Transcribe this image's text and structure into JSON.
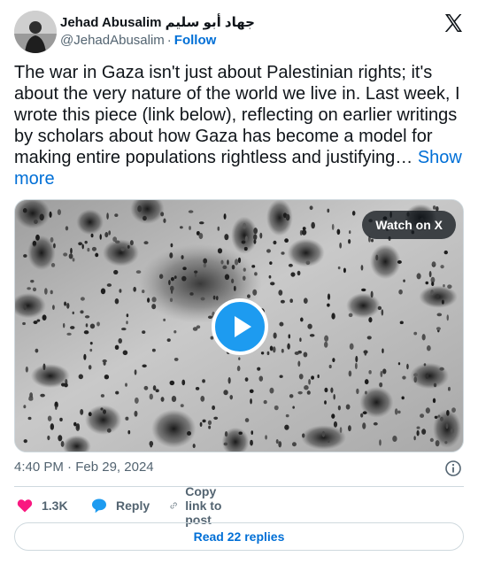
{
  "author": {
    "name": "Jehad Abusalim جهاد أبو سليم",
    "handle": "@JehadAbusalim",
    "separator": "·",
    "follow_label": "Follow"
  },
  "tweet": {
    "text": "The war in Gaza isn't just about Palestinian rights; it's about the very nature of the world we live in. Last week, I wrote this piece (link below), reflecting on earlier writings by scholars about how Gaza has become a model for making entire populations rightless and justifying…",
    "show_more": "Show more"
  },
  "media": {
    "watch_label": "Watch on X"
  },
  "meta": {
    "time": "4:40 PM",
    "separator": "·",
    "date": "Feb 29, 2024"
  },
  "actions": {
    "like_count": "1.3K",
    "reply_label": "Reply",
    "copy_label": "Copy link to post"
  },
  "footer": {
    "read_replies_label": "Read 22 replies"
  },
  "colors": {
    "link": "#006fd6",
    "like": "#f91880",
    "play": "#1d9bf0",
    "secondary_text": "#536471",
    "border": "#cfd9de"
  },
  "icons": [
    "x-logo-icon",
    "play-icon",
    "info-icon",
    "heart-icon",
    "speech-bubble-icon",
    "link-icon"
  ]
}
